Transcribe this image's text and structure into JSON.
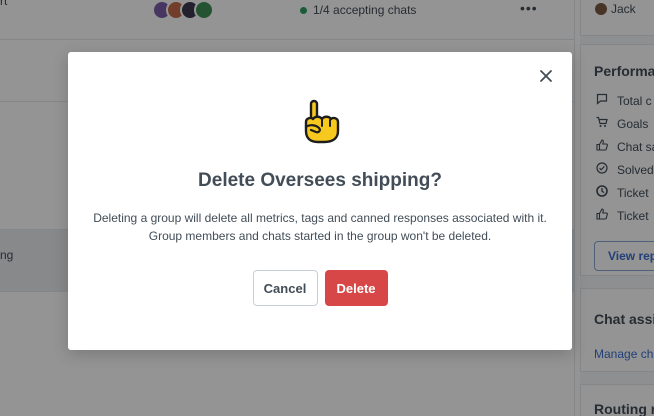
{
  "background": {
    "row1_fragment": "rt",
    "row1_status": "1/4 accepting chats",
    "row1_more": "•••",
    "row4_fragment": "ng",
    "agent_name": "Jack",
    "performance": {
      "title": "Performa",
      "items": [
        {
          "icon": "chat-bubble-icon",
          "label": "Total c"
        },
        {
          "icon": "cart-icon",
          "label": "Goals"
        },
        {
          "icon": "thumbs-up-icon",
          "label": "Chat sa"
        },
        {
          "icon": "check-circle-icon",
          "label": "Solved"
        },
        {
          "icon": "clock-icon",
          "label": "Ticket"
        },
        {
          "icon": "thumbs-up-icon",
          "label": "Ticket"
        }
      ],
      "view_button": "View rep"
    },
    "chat_assignment": {
      "title": "Chat assig",
      "link": "Manage cha"
    },
    "routing": {
      "title": "Routing r"
    }
  },
  "modal": {
    "icon": "pointing-up-finger-icon",
    "title": "Delete Oversees shipping?",
    "body_line1": "Deleting a group will delete all metrics, tags and canned responses associated with it.",
    "body_line2": "Group members and chats started in the group won't be deleted.",
    "cancel_label": "Cancel",
    "delete_label": "Delete"
  },
  "colors": {
    "danger": "#d74747",
    "link": "#3a6fd1",
    "status_online": "#2e9e62"
  }
}
